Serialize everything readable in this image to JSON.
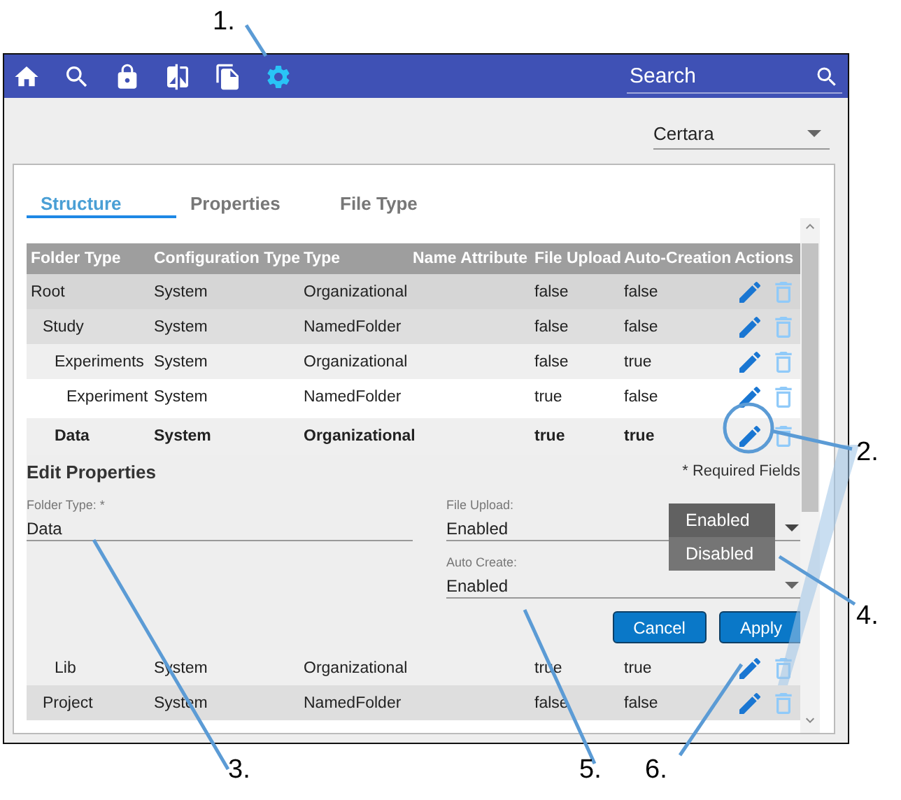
{
  "nav": {
    "items": [
      {
        "selected": false
      },
      {
        "selected": false
      },
      {
        "selected": false
      },
      {
        "selected": false
      },
      {
        "selected": false
      },
      {
        "selected": true
      }
    ],
    "search": {
      "placeholder": "Search"
    }
  },
  "organization": {
    "value": "Certara"
  },
  "tabs": [
    {
      "label": "Structure",
      "selected": true
    },
    {
      "label": "Properties",
      "selected": false
    },
    {
      "label": "File Type",
      "selected": false
    }
  ],
  "table": {
    "columns": [
      "Folder Type",
      "Configuration Type",
      "Type",
      "Name Attribute",
      "File Upload",
      "Auto-Creation",
      "Actions"
    ],
    "rows": [
      {
        "folder_type": "Root",
        "configuration_type": "System",
        "type": "Organizational",
        "file_upload": "false",
        "auto_creation": "false",
        "selected": false,
        "children": [
          {
            "folder_type": "Study",
            "configuration_type": "System",
            "type": "NamedFolder",
            "file_upload": "false",
            "auto_creation": "false",
            "selected": false,
            "children": [
              {
                "folder_type": "Experiments",
                "configuration_type": "System",
                "type": "Organizational",
                "file_upload": "false",
                "auto_creation": "true",
                "selected": false,
                "children": [
                  {
                    "folder_type": "Experiment",
                    "configuration_type": "System",
                    "type": "NamedFolder",
                    "file_upload": "true",
                    "auto_creation": "false",
                    "selected": false
                  }
                ]
              },
              {
                "folder_type": "Data",
                "configuration_type": "System",
                "type": "Organizational",
                "file_upload": "true",
                "auto_creation": "true",
                "selected": true
              },
              {
                "folder_type": "Lib",
                "configuration_type": "System",
                "type": "Organizational",
                "file_upload": "true",
                "auto_creation": "true",
                "selected": false
              }
            ]
          },
          {
            "folder_type": "Project",
            "configuration_type": "System",
            "type": "NamedFolder",
            "file_upload": "false",
            "auto_creation": "false",
            "selected": false
          }
        ]
      }
    ]
  },
  "edit_properties": {
    "title": "Edit Properties",
    "required_note": "* Required Fields",
    "fields": [
      {
        "kind": "text",
        "label": "Folder Type: *",
        "value": "Data"
      },
      {
        "kind": "select",
        "label": "File Upload:",
        "value": "Enabled",
        "expanded": true,
        "options": [
          {
            "label": "Enabled",
            "selected": true
          },
          {
            "label": "Disabled",
            "selected": false
          }
        ]
      },
      {
        "kind": "select",
        "label": "Auto Create:",
        "value": "Enabled",
        "expanded": false
      }
    ],
    "buttons": [
      "Cancel",
      "Apply"
    ]
  },
  "callouts": [
    "1.",
    "2.",
    "3.",
    "4.",
    "5.",
    "6."
  ]
}
